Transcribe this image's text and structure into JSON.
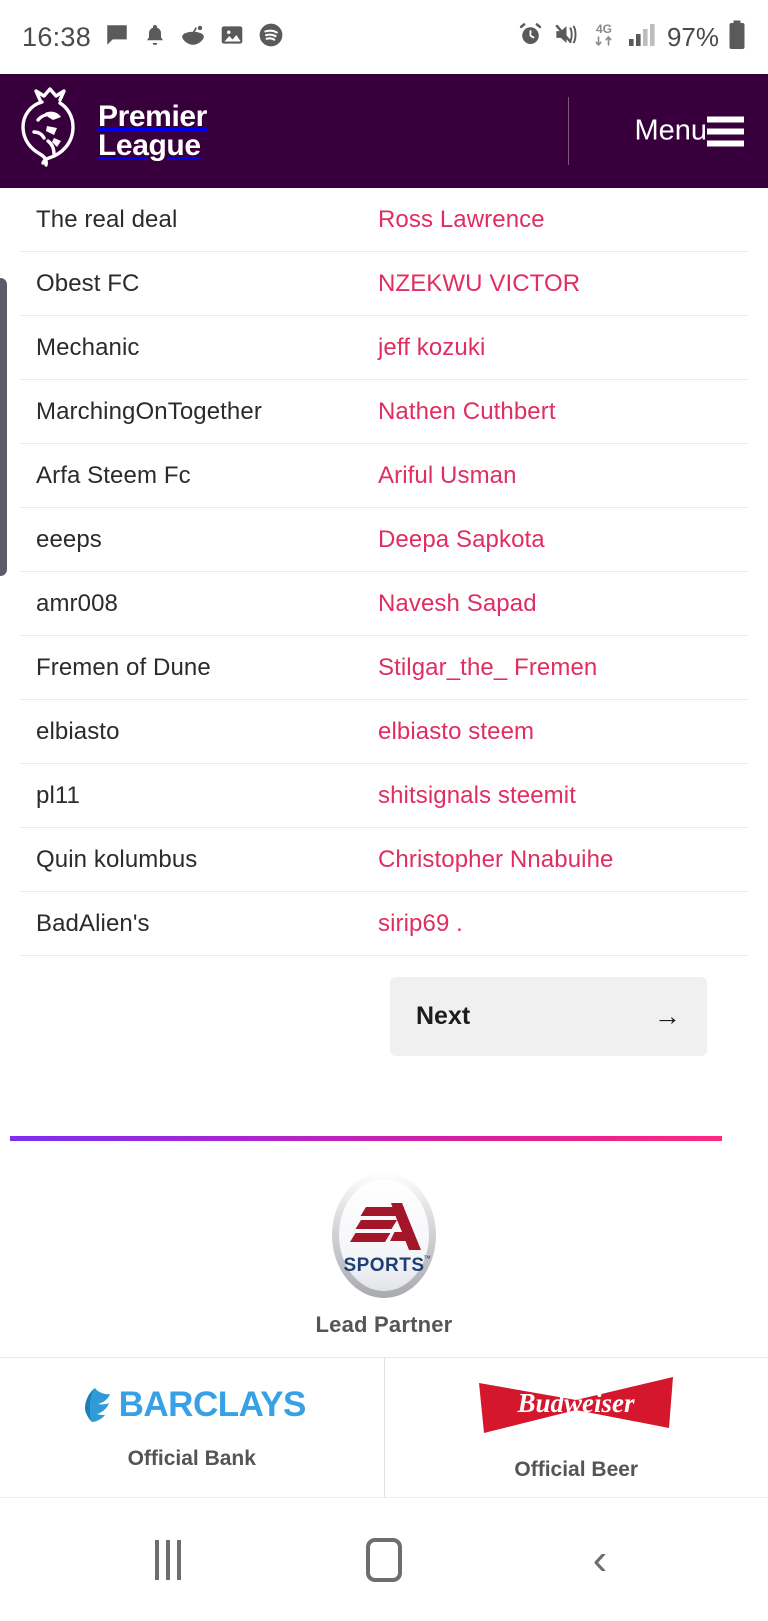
{
  "status_bar": {
    "time": "16:38",
    "battery_percent": "97%",
    "network_type": "4G",
    "left_icons": [
      "message-icon",
      "bell-icon",
      "reddit-icon",
      "gallery-icon",
      "spotify-icon"
    ],
    "right_icons": [
      "alarm-icon",
      "mute-vibrate-icon",
      "data-transfer-icon",
      "signal-bars-icon",
      "battery-icon"
    ]
  },
  "header": {
    "brand_line1": "Premier",
    "brand_line2": "League",
    "menu_label": "Menu",
    "background_color": "#37003c"
  },
  "table": {
    "rows": [
      {
        "team": "The real deal",
        "user": "Ross Lawrence"
      },
      {
        "team": "Obest FC",
        "user": "NZEKWU VICTOR"
      },
      {
        "team": "Mechanic",
        "user": "jeff kozuki"
      },
      {
        "team": "MarchingOnTogether",
        "user": "Nathen Cuthbert"
      },
      {
        "team": "Arfa Steem Fc",
        "user": "Ariful Usman"
      },
      {
        "team": "eeeps",
        "user": "Deepa Sapkota"
      },
      {
        "team": "amr008",
        "user": "Navesh Sapad"
      },
      {
        "team": "Fremen of Dune",
        "user": "Stilgar_the_ Fremen"
      },
      {
        "team": "elbiasto",
        "user": "elbiasto steem"
      },
      {
        "team": "pl11",
        "user": "shitsignals steemit"
      },
      {
        "team": "Quin kolumbus",
        "user": "Christopher Nnabuihe"
      },
      {
        "team": "BadAlien's",
        "user": "sirip69 ."
      }
    ],
    "team_color": "#2b2b2b",
    "user_color": "#e02d62"
  },
  "pagination": {
    "next_label": "Next",
    "next_arrow": "→"
  },
  "footer": {
    "gradient_from": "#7a2ff2",
    "gradient_to": "#ff2882",
    "lead_partner": {
      "logo_name": "ea-sports-logo",
      "logo_text_top": "EA",
      "logo_text_bottom": "SPORTS",
      "caption": "Lead Partner"
    },
    "partners": [
      {
        "logo_name": "barclays-logo",
        "logo_text": "BARCLAYS",
        "caption": "Official Bank",
        "color": "#38a1e5"
      },
      {
        "logo_name": "budweiser-logo",
        "logo_text": "Budweiser",
        "caption": "Official Beer",
        "color": "#d4172c"
      }
    ]
  },
  "nav_bar": {
    "items": [
      {
        "name": "recents-button",
        "glyph": "|||"
      },
      {
        "name": "home-button",
        "glyph": "◯"
      },
      {
        "name": "back-button",
        "glyph": "‹"
      }
    ]
  }
}
